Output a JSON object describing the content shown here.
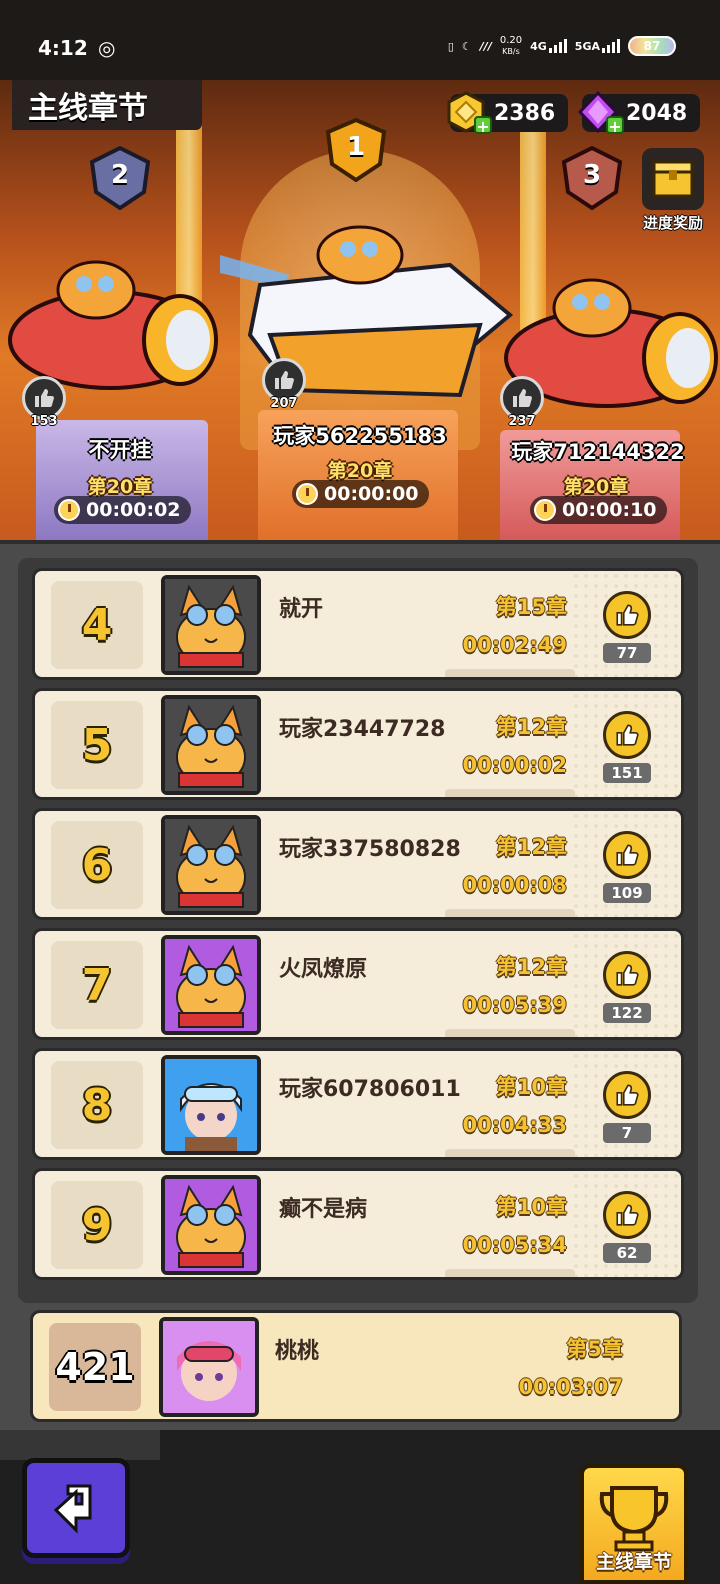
{
  "status_bar": {
    "time": "4:12",
    "net_speed_value": "0.20",
    "net_speed_unit": "KB/s",
    "network_1": "4G",
    "network_2": "5GA",
    "battery": "87"
  },
  "header": {
    "title": "主线章节",
    "gold": "2386",
    "gems": "2048",
    "progress_reward_label": "进度奖励"
  },
  "podium": [
    {
      "rank": "1",
      "name": "玩家562255183",
      "chapter": "第20章",
      "time": "00:00:00",
      "likes": "207"
    },
    {
      "rank": "2",
      "name": "不开挂",
      "chapter": "第20章",
      "time": "00:00:02",
      "likes": "153"
    },
    {
      "rank": "3",
      "name": "玩家712144322",
      "chapter": "第20章",
      "time": "00:00:10",
      "likes": "237"
    }
  ],
  "rows": [
    {
      "rank": "4",
      "name": "就开",
      "chapter": "第15章",
      "time": "00:02:49",
      "likes": "77",
      "avatar": "cat-pilot-icon"
    },
    {
      "rank": "5",
      "name": "玩家23447728",
      "chapter": "第12章",
      "time": "00:00:02",
      "likes": "151",
      "avatar": "cat-pilot-icon"
    },
    {
      "rank": "6",
      "name": "玩家337580828",
      "chapter": "第12章",
      "time": "00:00:08",
      "likes": "109",
      "avatar": "cat-pilot-icon"
    },
    {
      "rank": "7",
      "name": "火凤燎原",
      "chapter": "第12章",
      "time": "00:05:39",
      "likes": "122",
      "avatar": "cat-pilot-icon"
    },
    {
      "rank": "8",
      "name": "玩家607806011",
      "chapter": "第10章",
      "time": "00:04:33",
      "likes": "7",
      "avatar": "pilot-girl-icon"
    },
    {
      "rank": "9",
      "name": "癫不是病",
      "chapter": "第10章",
      "time": "00:05:34",
      "likes": "62",
      "avatar": "cat-pilot-icon"
    }
  ],
  "self_row": {
    "rank": "421",
    "name": "桃桃",
    "chapter": "第5章",
    "time": "00:03:07",
    "avatar": "pink-girl-icon"
  },
  "bottom": {
    "chapter_tab_label": "主线章节"
  },
  "colors": {
    "gold_text": "#f4c232",
    "row_bg": "#f5ecd9",
    "self_row_bg": "#f8e7bd",
    "back_button": "#5b3fd6"
  }
}
